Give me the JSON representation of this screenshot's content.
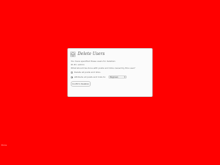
{
  "dialog": {
    "title": "Delete Users",
    "intro": "You have specified these users for deletion:",
    "user_line": "ID #1: admin",
    "question": "What should be done with posts and links owned by this user?",
    "options": [
      {
        "label": "Delete all posts and links.",
        "selected": false
      },
      {
        "label": "Attribute all posts and links to:",
        "selected": true,
        "select_value": "tbgroen"
      }
    ],
    "confirm_button": "Confirm Deletion"
  },
  "footer": {
    "text": "Done"
  },
  "colors": {
    "page_background": "#ff0000",
    "dialog_background": "#fbfbfb",
    "dialog_border": "#d7d7d7",
    "text": "#6b6b6b"
  }
}
